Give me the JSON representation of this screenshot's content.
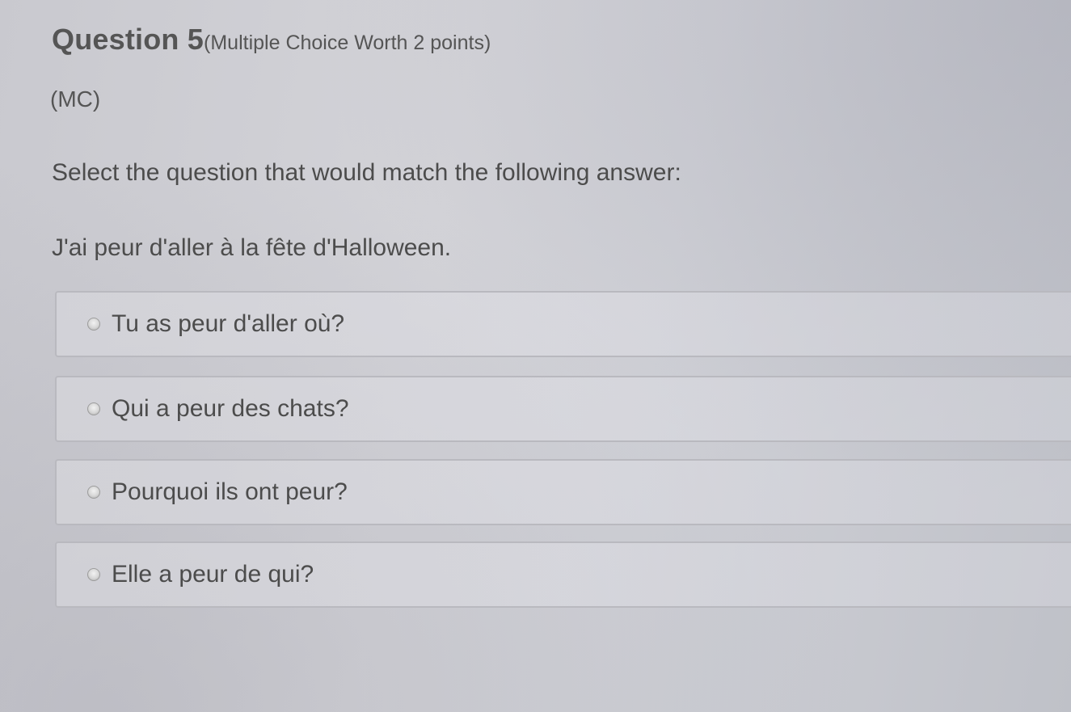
{
  "question": {
    "title": "Question 5",
    "meta": "(Multiple Choice Worth 2 points)",
    "type": "(MC)",
    "prompt": "Select the question that would match the following answer:",
    "statement": "J'ai peur d'aller à la fête d'Halloween."
  },
  "choices": [
    {
      "label": "Tu as peur d'aller où?"
    },
    {
      "label": "Qui a peur des chats?"
    },
    {
      "label": "Pourquoi ils ont peur?"
    },
    {
      "label": "Elle a peur de qui?"
    }
  ],
  "colors": {
    "text": "#4c4c4c",
    "choice_border": "#b9b9bf",
    "background": "#cfd0d6"
  },
  "icons": {
    "radio": "radio-button-unselected-icon"
  }
}
